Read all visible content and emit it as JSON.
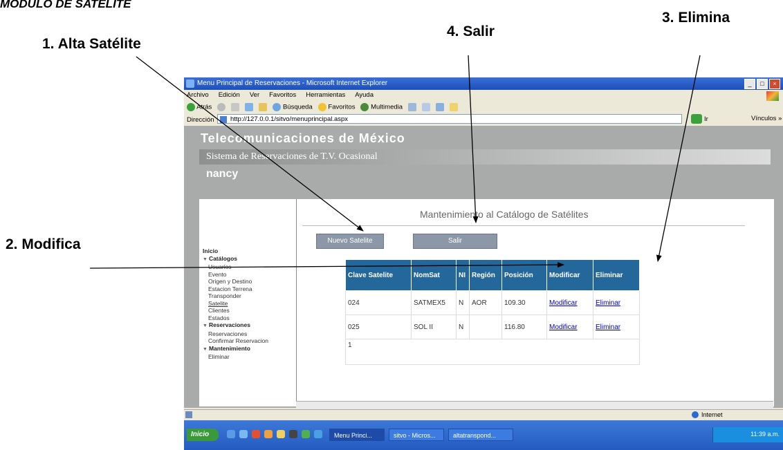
{
  "doc_title": "MODULO DE SATELITE",
  "callouts": {
    "alta": "1. Alta Satélite",
    "modifica": "2. Modifica",
    "elimina": "3. Elimina",
    "salir": "4. Salir"
  },
  "browser": {
    "window_title": "Menu Principal de Reservaciones - Microsoft Internet Explorer",
    "menu": [
      "Archivo",
      "Edición",
      "Ver",
      "Favoritos",
      "Herramientas",
      "Ayuda"
    ],
    "toolbar": {
      "back": "Atrás",
      "search": "Búsqueda",
      "favorites": "Favoritos",
      "multimedia": "Multimedia"
    },
    "address_label": "Dirección",
    "address": "http://127.0.0.1/sitvo/menuprincipal.aspx",
    "go_label": "Ir",
    "links_label": "Vínculos »",
    "status_zone": "Internet"
  },
  "app": {
    "title": "Telecomunicaciones de México",
    "system": "Sistema de Reservaciones de T.V. Ocasional",
    "user": "nancy",
    "page_title": "Mantenimiento al Catálogo de Satélites",
    "btn_new": "Nuevo Satelite",
    "btn_exit": "Salir"
  },
  "nav": [
    {
      "label": "Inicio",
      "type": "head"
    },
    {
      "label": "Catálogos",
      "type": "head",
      "expand": true
    },
    {
      "label": "Usuarios",
      "type": "sub"
    },
    {
      "label": "Evento",
      "type": "sub"
    },
    {
      "label": "Origen y Destino",
      "type": "sub"
    },
    {
      "label": "Estacion Terrena",
      "type": "sub"
    },
    {
      "label": "Transponder",
      "type": "sub"
    },
    {
      "label": "Satelite",
      "type": "sub",
      "active": true
    },
    {
      "label": "Clientes",
      "type": "sub"
    },
    {
      "label": "Estados",
      "type": "sub"
    },
    {
      "label": "Reservaciones",
      "type": "head",
      "expand": true
    },
    {
      "label": "Reservaciones",
      "type": "sub"
    },
    {
      "label": "Confirmar Reservacion",
      "type": "sub"
    },
    {
      "label": "Mantenimiento",
      "type": "head",
      "expand": true
    },
    {
      "label": "Eliminar",
      "type": "sub"
    }
  ],
  "table": {
    "headers": [
      "Clave Satelite",
      "NomSat",
      "NI",
      "Región",
      "Posición",
      "Modificar",
      "Eliminar"
    ],
    "rows": [
      [
        "024",
        "SATMEX5",
        "N",
        "AOR",
        "109.30",
        "Modificar",
        "Eliminar"
      ],
      [
        "025",
        "SOL II",
        "N",
        "",
        "116.80",
        "Modificar",
        "Eliminar"
      ]
    ],
    "pager": "1"
  },
  "taskbar": {
    "start": "Inicio",
    "tasks": [
      "Menu Princi...",
      "sitvo - Micros...",
      "altatranspond..."
    ],
    "clock": "11:39 a.m."
  }
}
